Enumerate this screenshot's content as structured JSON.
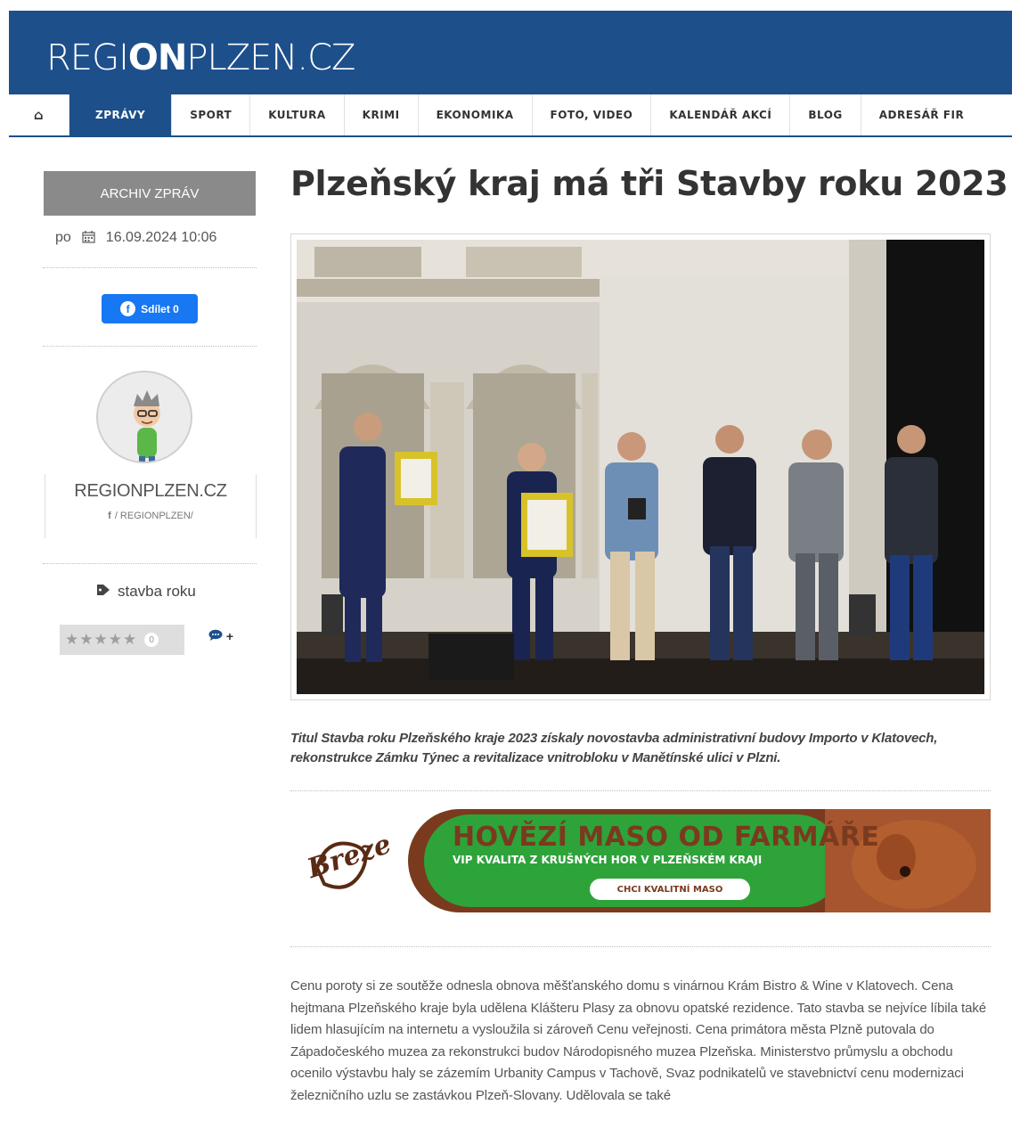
{
  "site": {
    "logo_pre": "REGI",
    "logo_on": "ON",
    "logo_post": "PLZEN.CZ"
  },
  "nav": {
    "home_icon": "home-icon",
    "items": [
      "ZPRÁVY",
      "SPORT",
      "KULTURA",
      "KRIMI",
      "EKONOMIKA",
      "FOTO, VIDEO",
      "KALENDÁŘ AKCÍ",
      "BLOG",
      "ADRESÁŘ FIR"
    ],
    "active_index": 0
  },
  "sidebar": {
    "archive_label": "ARCHIV ZPRÁV",
    "weekday": "po",
    "datetime": "16.09.2024 10:06",
    "share_label": "Sdílet 0",
    "author_name": "REGIONPLZEN.CZ",
    "author_link": "/ REGIONPLZEN/",
    "tag": "stavba roku",
    "rating_stars": "★★★★★",
    "rating_count": "0",
    "comment_plus": "+"
  },
  "article": {
    "title": "Plzeňský kraj má tři Stavby roku 2023",
    "caption": "Titul Stavba roku Plzeňského kraje 2023 získaly novostavba administrativní budovy Importo v Klatovech, rekonstrukce Zámku Týnec a revitalizace vnitrobloku v Manětínské ulici v Plzni.",
    "body": "Cenu poroty si ze soutěže odnesla obnova měšťanského domu s vinárnou Krám Bistro & Wine v Klatovech. Cena hejtmana Plzeňského kraje byla udělena Klášteru Plasy za obnovu opatské rezidence. Tato stavba se nejvíce líbila také lidem hlasujícím na internetu a vysloužila si zároveň Cenu veřejnosti. Cena primátora města Plzně putovala do Západočeského muzea za rekonstrukci budov Národopisného muzea Plzeňska. Ministerstvo průmyslu a obchodu ocenilo výstavbu haly se zázemím Urbanity Campus v Tachově, Svaz podnikatelů ve stavebnictví cenu modernizaci železničního uzlu se zastávkou Plzeň-Slovany. Udělovala se také"
  },
  "banner": {
    "brand": "Breze",
    "headline": "HOVĚZÍ MASO OD FARMÁŘE",
    "subline": "VIP KVALITA Z KRUŠNÝCH HOR  V  PLZEŇSKÉM KRAJI",
    "cta": "CHCI KVALITNÍ MASO"
  },
  "colors": {
    "header_blue": "#1d4f8b",
    "banner_green": "#2ea33a",
    "banner_brown": "#7a3a1e",
    "facebook": "#1877f2"
  }
}
